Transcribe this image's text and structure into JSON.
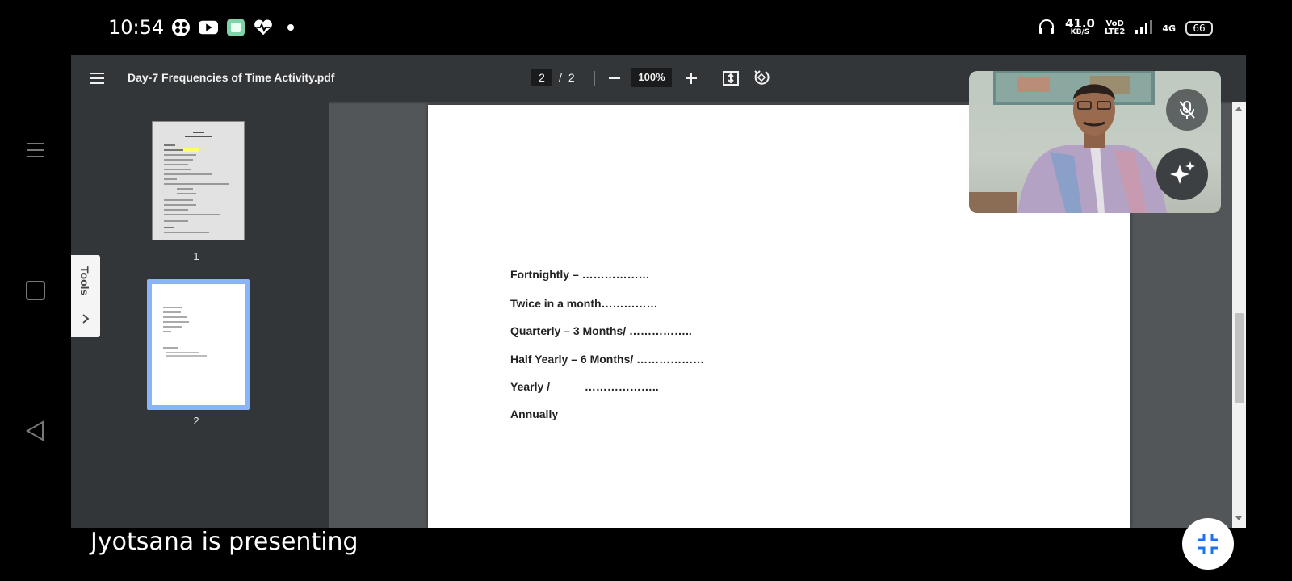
{
  "status_bar": {
    "time": "10:54",
    "network_speed_value": "41.0",
    "network_speed_unit": "KB/S",
    "vod_top": "VoD",
    "vod_bottom": "LTE2",
    "network_type": "4G",
    "battery_level": "66",
    "app_icons": [
      "grid-app-icon",
      "youtube-icon",
      "green-app-icon",
      "heart-icon",
      "dot-icon"
    ]
  },
  "pdf_viewer": {
    "title": "Day-7 Frequencies of Time Activity.pdf",
    "current_page": "2",
    "page_separator": "/",
    "total_pages": "2",
    "zoom": "100%",
    "tools_label": "Tools",
    "thumbnails": [
      {
        "label": "1"
      },
      {
        "label": "2"
      }
    ],
    "page_lines": [
      "Fortnightly – ………………",
      "Twice in a month……………",
      "Quarterly – 3 Months/ ……………..",
      "Half Yearly – 6 Months/ ………………",
      "Yearly /           ………………..",
      "Annually"
    ]
  },
  "meeting": {
    "presenting_text": "Jyotsana is presenting"
  },
  "colors": {
    "toolbar_bg": "#323639",
    "viewer_bg": "#525659",
    "selected_thumb": "#8ab4f8",
    "exit_icon": "#1a73e8"
  }
}
